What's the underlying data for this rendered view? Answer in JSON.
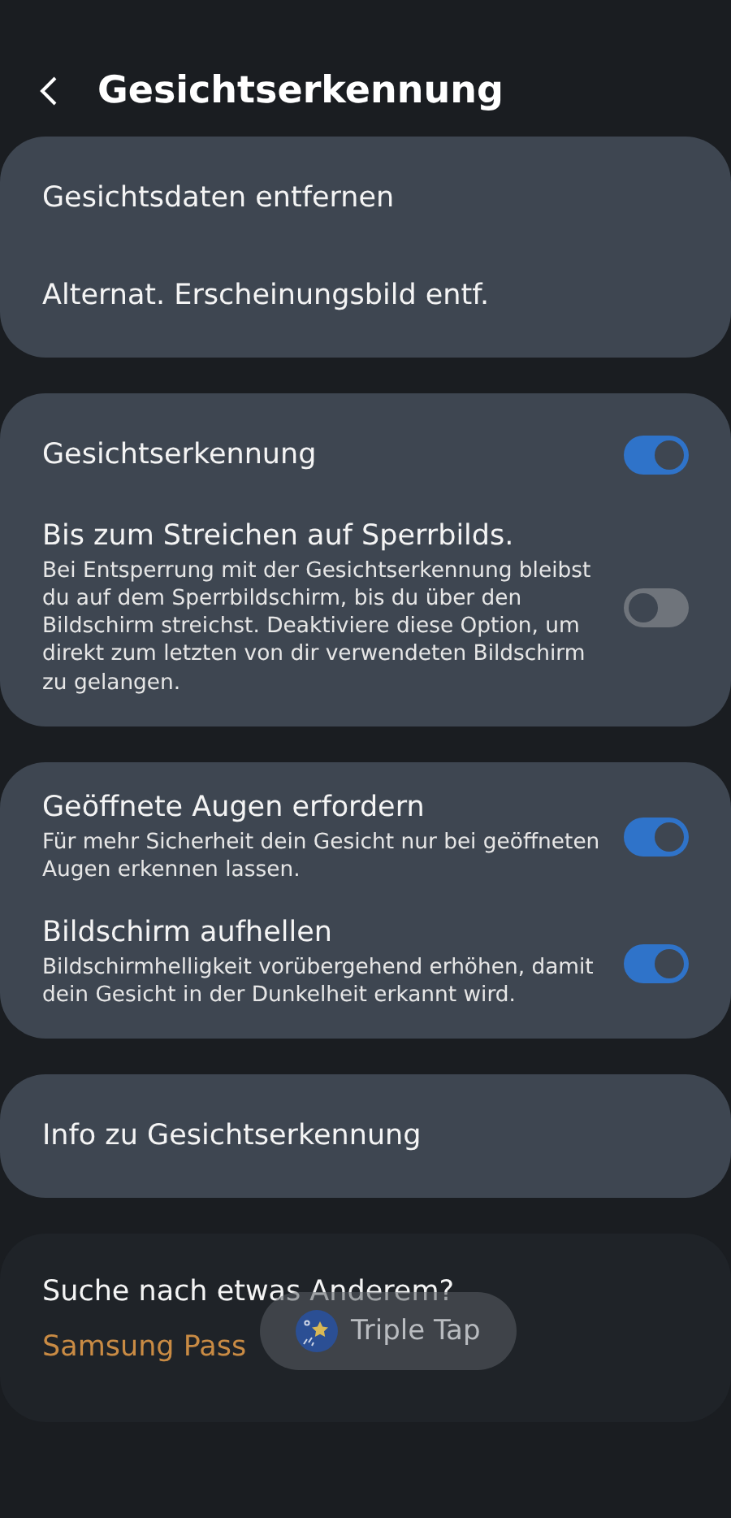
{
  "header": {
    "title": "Gesichtserkennung"
  },
  "groups": [
    {
      "items": [
        {
          "kind": "action",
          "title": "Gesichtsdaten entfernen"
        },
        {
          "kind": "action",
          "title": "Alternat. Erscheinungsbild entf."
        }
      ]
    },
    {
      "items": [
        {
          "kind": "toggle",
          "title": "Gesichtserkennung",
          "on": true
        },
        {
          "kind": "toggle",
          "title": "Bis zum Streichen auf Sperrbilds.",
          "description": "Bei Entsperrung mit der Gesichtserkennung bleibst du auf dem Sperrbildschirm, bis du über den Bildschirm streichst. Deaktiviere diese Option, um direkt zum letzten von dir verwendeten Bildschirm zu gelangen.",
          "on": false
        }
      ]
    },
    {
      "items": [
        {
          "kind": "toggle",
          "title": "Geöffnete Augen erfordern",
          "description": "Für mehr Sicherheit dein Gesicht nur bei geöffneten Augen erkennen lassen.",
          "on": true
        },
        {
          "kind": "toggle",
          "title": "Bildschirm aufhellen",
          "description": "Bildschirmhelligkeit vorübergehend erhöhen, damit dein Gesicht in der Dunkelheit erkannt wird.",
          "on": true
        }
      ]
    },
    {
      "items": [
        {
          "kind": "action",
          "title": "Info zu Gesichtserkennung"
        }
      ]
    }
  ],
  "suggestions": {
    "heading": "Suche nach etwas Anderem?",
    "links": [
      "Samsung Pass"
    ]
  },
  "overlay": {
    "label": "Triple Tap"
  }
}
